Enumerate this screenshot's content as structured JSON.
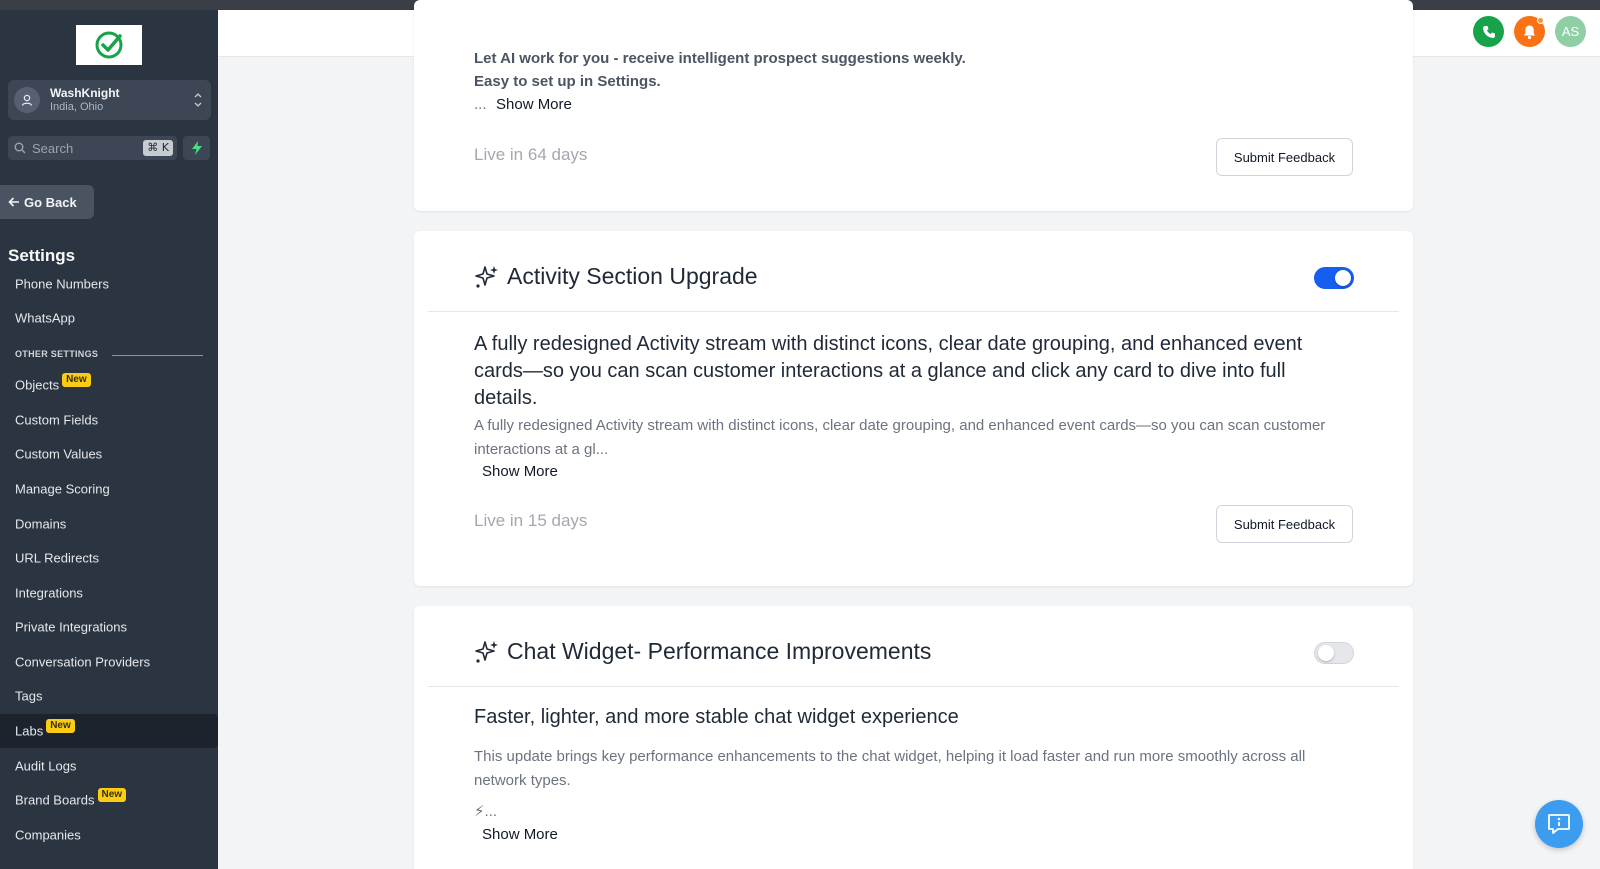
{
  "sidebar": {
    "account": {
      "name": "WashKnight",
      "location": "India, Ohio"
    },
    "search": {
      "placeholder": "Search",
      "shortcut": "⌘ K"
    },
    "go_back": "Go Back",
    "section_title": "Settings",
    "items_top": [
      {
        "label": "Phone Numbers"
      },
      {
        "label": "WhatsApp"
      }
    ],
    "other_settings_label": "OTHER SETTINGS",
    "items": [
      {
        "label": "Objects",
        "badge": "New"
      },
      {
        "label": "Custom Fields"
      },
      {
        "label": "Custom Values"
      },
      {
        "label": "Manage Scoring"
      },
      {
        "label": "Domains"
      },
      {
        "label": "URL Redirects"
      },
      {
        "label": "Integrations"
      },
      {
        "label": "Private Integrations"
      },
      {
        "label": "Conversation Providers"
      },
      {
        "label": "Tags"
      },
      {
        "label": "Labs",
        "badge": "New",
        "active": true
      },
      {
        "label": "Audit Logs"
      },
      {
        "label": "Brand Boards",
        "badge": "New"
      },
      {
        "label": "Companies"
      }
    ]
  },
  "header": {
    "avatar_initials": "AS"
  },
  "cards": [
    {
      "line1": "Let AI work for you - receive intelligent prospect suggestions weekly.",
      "line2": "Easy to set up in Settings.",
      "ellipsis": "...",
      "show_more": "Show More",
      "live": "Live in 64 days",
      "feedback": "Submit Feedback"
    },
    {
      "title": "Activity Section Upgrade",
      "enabled": true,
      "headline": "A fully redesigned Activity stream with distinct icons, clear date grouping, and enhanced event cards—so you can scan customer interactions at a glance and click any card to dive into full details.",
      "description": "A fully redesigned Activity stream with distinct icons, clear date grouping, and enhanced event cards—so you can scan customer interactions at a gl...",
      "show_more": "Show More",
      "live": "Live in 15 days",
      "feedback": "Submit Feedback"
    },
    {
      "title": "Chat Widget- Performance Improvements",
      "enabled": false,
      "headline": "Faster, lighter, and more stable chat widget experience",
      "description": "This update brings key performance enhancements to the chat widget, helping it load faster and run more smoothly across all network types.",
      "bolt_line": "⚡...",
      "show_more": "Show More"
    }
  ],
  "colors": {
    "sidebar_bg": "#2b3441",
    "accent_blue": "#155eef",
    "badge_yellow": "#facc15",
    "phone_green": "#16a34a",
    "bell_orange": "#f97316",
    "avatar_green": "#8fcfa6"
  },
  "icons": {
    "logo": "check-circle-icon",
    "account": "user-icon",
    "search": "search-icon",
    "quick_action": "bolt-icon",
    "back": "arrow-left-icon",
    "card_title": "sparkle-icon",
    "phone": "phone-icon",
    "notifications": "bell-icon",
    "support": "chat-info-icon"
  }
}
